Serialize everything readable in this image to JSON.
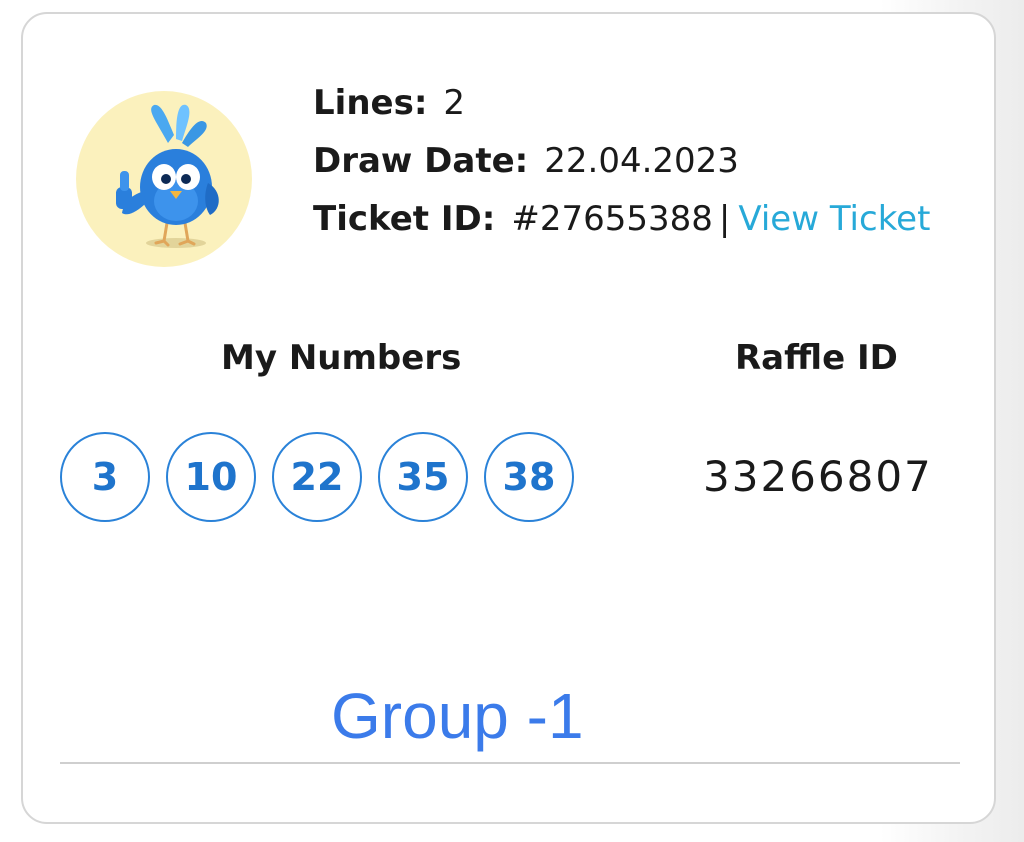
{
  "ticket": {
    "mascot_icon": "bird-mascot-thumbs-up",
    "lines_label": "Lines:",
    "lines_value": "2",
    "draw_date_label": "Draw Date:",
    "draw_date_value": "22.04.2023",
    "ticket_id_label": "Ticket ID:",
    "ticket_id_value": "#27655388",
    "separator": "|",
    "view_ticket_label": "View Ticket"
  },
  "numbers": {
    "title": "My Numbers",
    "values": [
      "3",
      "10",
      "22",
      "35",
      "38"
    ]
  },
  "raffle": {
    "title": "Raffle ID",
    "value": "33266807"
  },
  "group": {
    "label": "Group -1"
  },
  "colors": {
    "link": "#27a9d8",
    "ball_border": "#2a82d8",
    "ball_text": "#1f74cc",
    "group_text": "#3b7bea",
    "avatar_bg": "#fbf1bd"
  }
}
